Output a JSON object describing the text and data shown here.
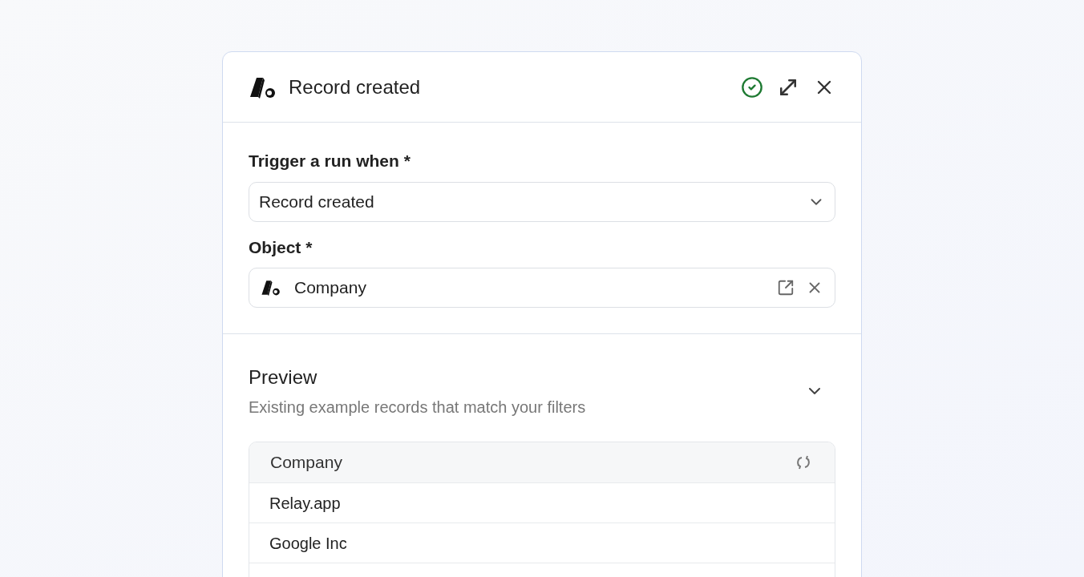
{
  "panel": {
    "title": "Record created",
    "status_ok": true
  },
  "fields": [
    {
      "label": "Trigger a run when *",
      "kind": "select",
      "value": "Record created"
    },
    {
      "label": "Object *",
      "kind": "object",
      "value": "Company"
    }
  ],
  "preview": {
    "title": "Preview",
    "subtitle": "Existing example records that match your filters",
    "expanded": true,
    "table": {
      "column": "Company",
      "rows": [
        "Relay.app",
        "Google Inc"
      ]
    }
  }
}
